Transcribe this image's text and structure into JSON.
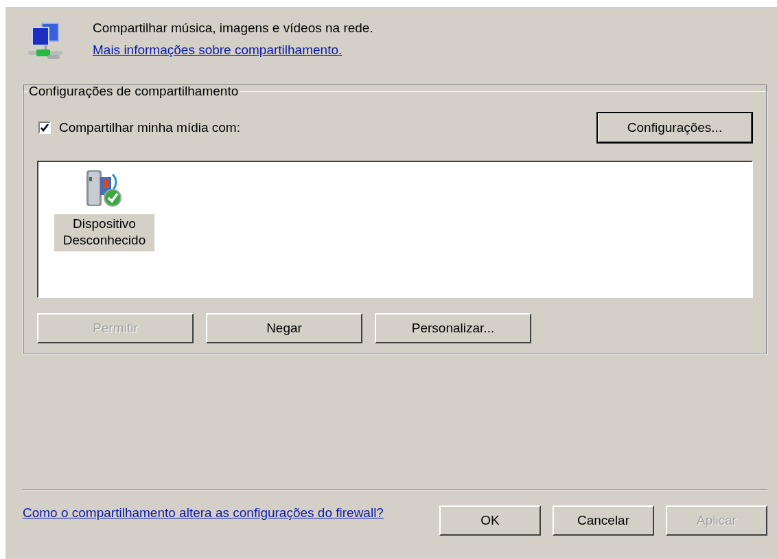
{
  "header": {
    "text": "Compartilhar música, imagens e vídeos na rede.",
    "link": "Mais informações sobre compartilhamento."
  },
  "group": {
    "title": "Configurações de compartilhamento",
    "share_checkbox": {
      "label": "Compartilhar minha mídia com:",
      "checked": true
    },
    "settings_button": "Configurações...",
    "devices": [
      {
        "name": "Dispositivo Desconhecido",
        "selected": true
      }
    ],
    "buttons": [
      {
        "label": "Permitir",
        "disabled": true
      },
      {
        "label": "Negar",
        "disabled": false
      },
      {
        "label": "Personalizar...",
        "disabled": false
      }
    ]
  },
  "footer": {
    "link": "Como o compartilhamento altera as configurações do firewall?",
    "buttons": [
      {
        "label": "OK",
        "disabled": false
      },
      {
        "label": "Cancelar",
        "disabled": false
      },
      {
        "label": "Aplicar",
        "disabled": true
      }
    ]
  }
}
